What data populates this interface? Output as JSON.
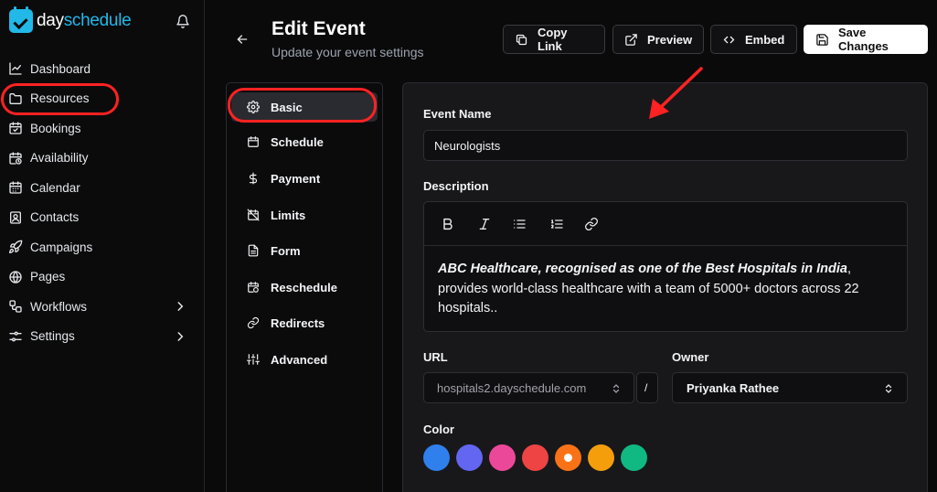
{
  "app": {
    "logo_day": "day",
    "logo_schedule": "schedule"
  },
  "sidebar": {
    "items": [
      {
        "label": "Dashboard",
        "icon": "chart-line-icon"
      },
      {
        "label": "Resources",
        "icon": "folder-icon"
      },
      {
        "label": "Bookings",
        "icon": "calendar-check-icon"
      },
      {
        "label": "Availability",
        "icon": "calendar-clock-icon"
      },
      {
        "label": "Calendar",
        "icon": "calendar-icon"
      },
      {
        "label": "Contacts",
        "icon": "contact-card-icon"
      },
      {
        "label": "Campaigns",
        "icon": "rocket-icon"
      },
      {
        "label": "Pages",
        "icon": "globe-icon"
      },
      {
        "label": "Workflows",
        "icon": "workflow-icon"
      },
      {
        "label": "Settings",
        "icon": "sliders-icon"
      }
    ]
  },
  "header": {
    "title": "Edit Event",
    "subtitle": "Update your event settings",
    "buttons": {
      "copy_link": "Copy Link",
      "preview": "Preview",
      "embed": "Embed",
      "save": "Save Changes"
    }
  },
  "settings_menu": {
    "items": [
      {
        "label": "Basic",
        "active": true
      },
      {
        "label": "Schedule"
      },
      {
        "label": "Payment"
      },
      {
        "label": "Limits"
      },
      {
        "label": "Form"
      },
      {
        "label": "Reschedule"
      },
      {
        "label": "Redirects"
      },
      {
        "label": "Advanced"
      }
    ]
  },
  "form": {
    "event_name_label": "Event Name",
    "event_name_value": "Neurologists",
    "description_label": "Description",
    "description_bold_italic": "ABC Healthcare, recognised as one of the Best Hospitals in India",
    "description_rest": ", provides world-class healthcare with a team of 5000+ doctors across 22 hospitals..",
    "url_label": "URL",
    "url_domain": "hospitals2.dayschedule.com",
    "url_separator": "/",
    "owner_label": "Owner",
    "owner_value": "Priyanka Rathee",
    "color_label": "Color",
    "colors": [
      "#2f80ed",
      "#6366f1",
      "#ec4899",
      "#ef4444",
      "#f97316",
      "#f59e0b",
      "#10b981"
    ],
    "selected_color_index": 4
  },
  "annotation_color": "#ff2222"
}
